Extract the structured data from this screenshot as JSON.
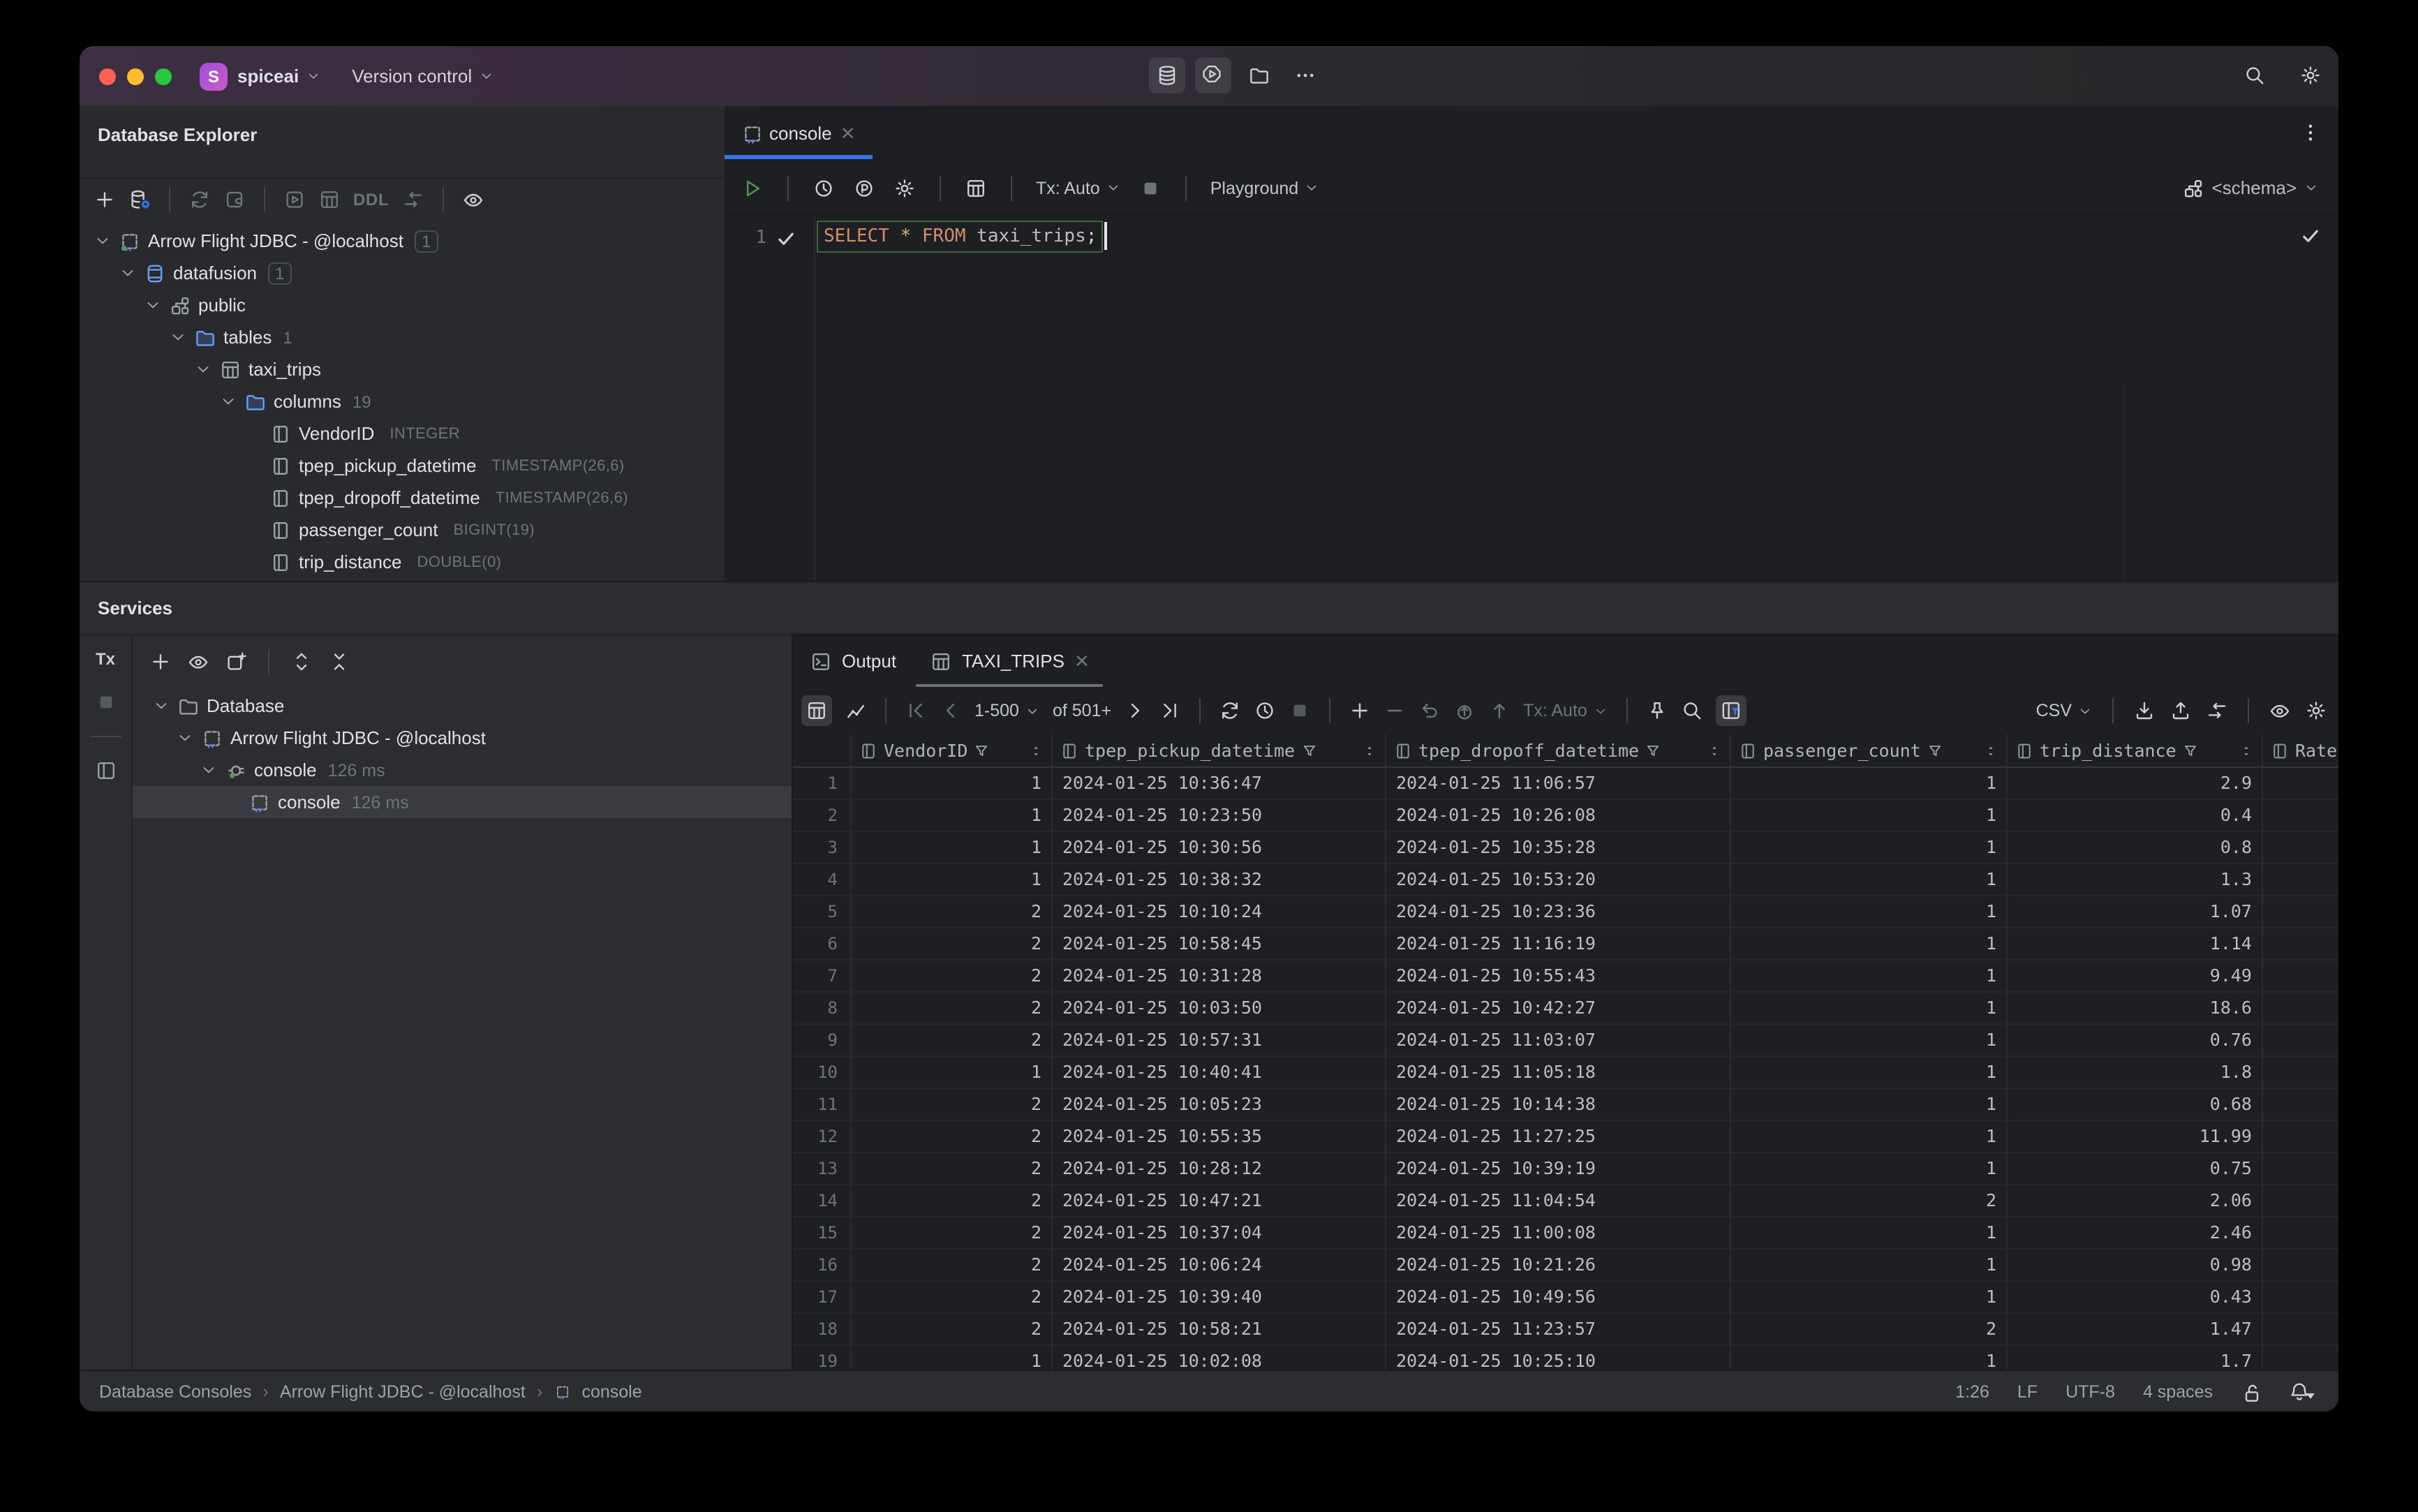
{
  "colors": {
    "accent_blue": "#3574F0",
    "run_green": "#57965C",
    "keyword_orange": "#CF8E6D",
    "star_yellow": "#D5B778",
    "selection_gray": "#393B40"
  },
  "titlebar": {
    "project": "spiceai",
    "avatar_letter": "S",
    "menu": "Version control"
  },
  "explorer": {
    "title": "Database Explorer",
    "ddl_label": "DDL",
    "tree": [
      {
        "label": "Arrow Flight JDBC - @localhost",
        "badge": "1",
        "boxed": true,
        "icon": "connection",
        "level": 0,
        "chevron": true
      },
      {
        "label": "datafusion",
        "badge": "1",
        "boxed": true,
        "icon": "database-blue",
        "level": 1,
        "chevron": true
      },
      {
        "label": "public",
        "icon": "schema",
        "level": 2,
        "chevron": true
      },
      {
        "label": "tables",
        "badge": "1",
        "icon": "folder-blue",
        "level": 3,
        "chevron": true
      },
      {
        "label": "taxi_trips",
        "icon": "table-grid",
        "level": 4,
        "chevron": true
      },
      {
        "label": "columns",
        "badge": "19",
        "icon": "folder-blue",
        "level": 5,
        "chevron": true
      },
      {
        "label": "VendorID",
        "type": "INTEGER",
        "icon": "column",
        "level": 6
      },
      {
        "label": "tpep_pickup_datetime",
        "type": "TIMESTAMP(26,6)",
        "icon": "column",
        "level": 6
      },
      {
        "label": "tpep_dropoff_datetime",
        "type": "TIMESTAMP(26,6)",
        "icon": "column",
        "level": 6
      },
      {
        "label": "passenger_count",
        "type": "BIGINT(19)",
        "icon": "column",
        "level": 6
      },
      {
        "label": "trip_distance",
        "type": "DOUBLE(0)",
        "icon": "column",
        "level": 6
      }
    ]
  },
  "editor": {
    "tab_label": "console",
    "toolbar": {
      "tx": "Tx: Auto",
      "playground": "Playground",
      "schema": "<schema>"
    },
    "line_number": "1",
    "sql_tokens": [
      {
        "text": "SELECT",
        "color": "#CF8E6D"
      },
      {
        "text": " ",
        "color": ""
      },
      {
        "text": "*",
        "color": "#D5B778"
      },
      {
        "text": " ",
        "color": ""
      },
      {
        "text": "FROM",
        "color": "#CF8E6D"
      },
      {
        "text": " taxi_trips",
        "color": "#BCBEC4"
      },
      {
        "text": ";",
        "color": "#D6D8DC"
      }
    ]
  },
  "services": {
    "title": "Services",
    "tx_label": "Tx",
    "tree": [
      {
        "label": "Database",
        "icon": "folder-gray",
        "level": 0,
        "chevron": true
      },
      {
        "label": "Arrow Flight JDBC - @localhost",
        "icon": "console",
        "level": 1,
        "chevron": true
      },
      {
        "label": "console",
        "meta": "126 ms",
        "icon": "plug",
        "level": 2,
        "chevron": true
      },
      {
        "label": "console",
        "meta": "126 ms",
        "icon": "console",
        "level": 3,
        "selected": true
      }
    ]
  },
  "output": {
    "tabs": [
      {
        "label": "Output"
      },
      {
        "label": "TAXI_TRIPS"
      }
    ],
    "toolbar": {
      "page_range": "1-500",
      "page_total": "of 501+",
      "tx": "Tx: Auto",
      "format": "CSV"
    },
    "grid": {
      "columns": [
        "VendorID",
        "tpep_pickup_datetime",
        "tpep_dropoff_datetime",
        "passenger_count",
        "trip_distance",
        "Rate"
      ],
      "rows": [
        [
          "1",
          "2024-01-25 10:36:47",
          "2024-01-25 11:06:57",
          "1",
          "2.9"
        ],
        [
          "1",
          "2024-01-25 10:23:50",
          "2024-01-25 10:26:08",
          "1",
          "0.4"
        ],
        [
          "1",
          "2024-01-25 10:30:56",
          "2024-01-25 10:35:28",
          "1",
          "0.8"
        ],
        [
          "1",
          "2024-01-25 10:38:32",
          "2024-01-25 10:53:20",
          "1",
          "1.3"
        ],
        [
          "2",
          "2024-01-25 10:10:24",
          "2024-01-25 10:23:36",
          "1",
          "1.07"
        ],
        [
          "2",
          "2024-01-25 10:58:45",
          "2024-01-25 11:16:19",
          "1",
          "1.14"
        ],
        [
          "2",
          "2024-01-25 10:31:28",
          "2024-01-25 10:55:43",
          "1",
          "9.49"
        ],
        [
          "2",
          "2024-01-25 10:03:50",
          "2024-01-25 10:42:27",
          "1",
          "18.6"
        ],
        [
          "2",
          "2024-01-25 10:57:31",
          "2024-01-25 11:03:07",
          "1",
          "0.76"
        ],
        [
          "1",
          "2024-01-25 10:40:41",
          "2024-01-25 11:05:18",
          "1",
          "1.8"
        ],
        [
          "2",
          "2024-01-25 10:05:23",
          "2024-01-25 10:14:38",
          "1",
          "0.68"
        ],
        [
          "2",
          "2024-01-25 10:55:35",
          "2024-01-25 11:27:25",
          "1",
          "11.99"
        ],
        [
          "2",
          "2024-01-25 10:28:12",
          "2024-01-25 10:39:19",
          "1",
          "0.75"
        ],
        [
          "2",
          "2024-01-25 10:47:21",
          "2024-01-25 11:04:54",
          "2",
          "2.06"
        ],
        [
          "2",
          "2024-01-25 10:37:04",
          "2024-01-25 11:00:08",
          "1",
          "2.46"
        ],
        [
          "2",
          "2024-01-25 10:06:24",
          "2024-01-25 10:21:26",
          "1",
          "0.98"
        ],
        [
          "2",
          "2024-01-25 10:39:40",
          "2024-01-25 10:49:56",
          "1",
          "0.43"
        ],
        [
          "2",
          "2024-01-25 10:58:21",
          "2024-01-25 11:23:57",
          "2",
          "1.47"
        ],
        [
          "1",
          "2024-01-25 10:02:08",
          "2024-01-25 10:25:10",
          "1",
          "1.7"
        ]
      ]
    }
  },
  "statusbar": {
    "breadcrumbs": [
      "Database Consoles",
      "Arrow Flight JDBC - @localhost",
      "console"
    ],
    "caret": "1:26",
    "line_sep": "LF",
    "encoding": "UTF-8",
    "indent": "4 spaces"
  }
}
